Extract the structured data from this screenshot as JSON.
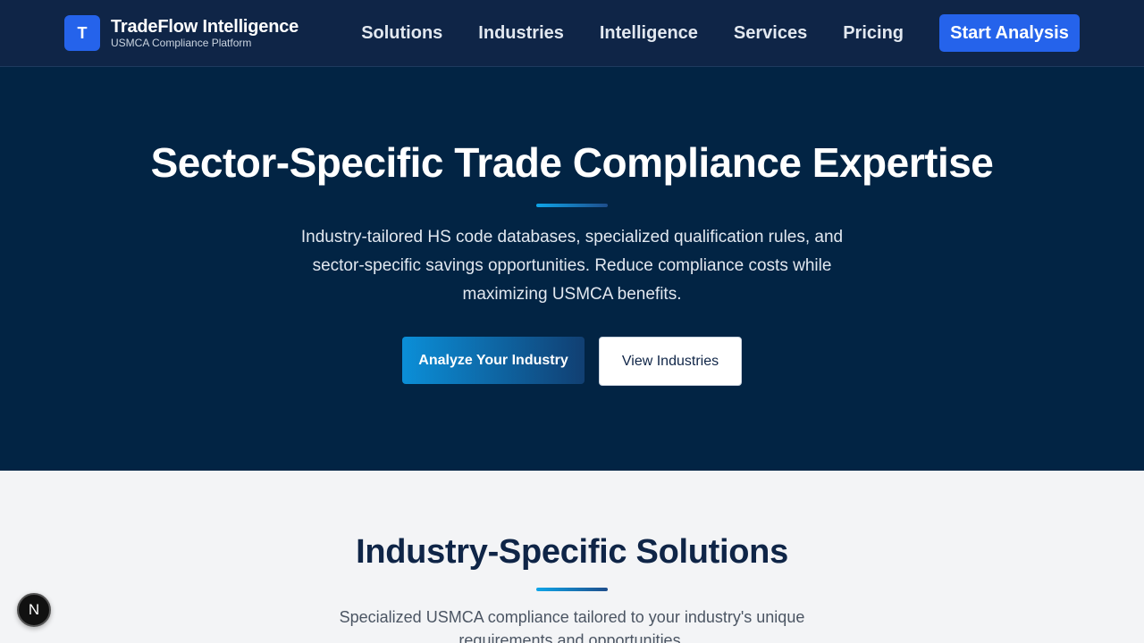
{
  "navbar": {
    "logo_letter": "T",
    "brand_name": "TradeFlow Intelligence",
    "brand_tagline": "USMCA Compliance Platform",
    "links": [
      "Solutions",
      "Industries",
      "Intelligence",
      "Services",
      "Pricing"
    ],
    "cta_label": "Start Analysis"
  },
  "hero": {
    "title": "Sector-Specific Trade Compliance Expertise",
    "description": "Industry-tailored HS code databases, specialized qualification rules, and sector-specific savings opportunities. Reduce compliance costs while maximizing USMCA benefits.",
    "primary_button": "Analyze Your Industry",
    "secondary_button": "View Industries"
  },
  "solutions": {
    "title": "Industry-Specific Solutions",
    "description": "Specialized USMCA compliance tailored to your industry's unique requirements and opportunities."
  },
  "dev_badge": {
    "letter": "N",
    "icon": "nextjs-icon"
  },
  "colors": {
    "navbar_bg": "#0f2547",
    "hero_bg": "#022444",
    "accent": "#2563eb",
    "section_bg": "#f3f4f6"
  }
}
